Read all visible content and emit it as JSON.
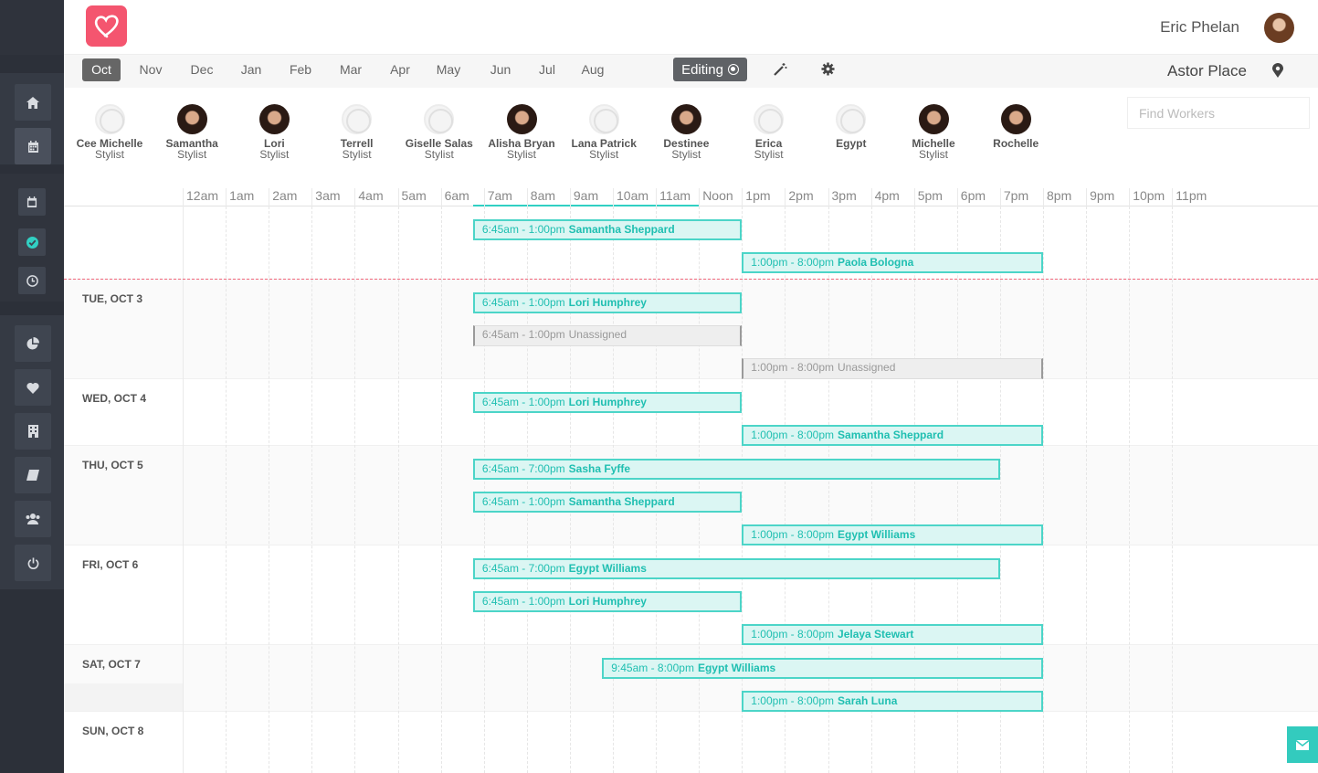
{
  "header": {
    "user_name": "Eric Phelan"
  },
  "toolbar": {
    "months": [
      "Oct",
      "Nov",
      "Dec",
      "Jan",
      "Feb",
      "Mar",
      "Apr",
      "May",
      "Jun",
      "Jul",
      "Aug"
    ],
    "active_month": "Oct",
    "editing_label": "Editing",
    "location": "Astor Place"
  },
  "workers": [
    {
      "name": "Cee Michelle",
      "role": "Stylist",
      "avatar": "placeholder"
    },
    {
      "name": "Samantha",
      "role": "Stylist",
      "avatar": "photo"
    },
    {
      "name": "Lori",
      "role": "Stylist",
      "avatar": "photo"
    },
    {
      "name": "Terrell",
      "role": "Stylist",
      "avatar": "placeholder"
    },
    {
      "name": "Giselle Salas",
      "role": "Stylist",
      "avatar": "placeholder"
    },
    {
      "name": "Alisha Bryan",
      "role": "Stylist",
      "avatar": "photo"
    },
    {
      "name": "Lana Patrick",
      "role": "Stylist",
      "avatar": "placeholder"
    },
    {
      "name": "Destinee",
      "role": "Stylist",
      "avatar": "photo"
    },
    {
      "name": "Erica",
      "role": "Stylist",
      "avatar": "placeholder"
    },
    {
      "name": "Egypt",
      "role": "",
      "avatar": "placeholder"
    },
    {
      "name": "Michelle",
      "role": "Stylist",
      "avatar": "photo"
    },
    {
      "name": "Rochelle",
      "role": "",
      "avatar": "photo"
    }
  ],
  "search": {
    "placeholder": "Find Workers"
  },
  "hours": [
    "12am",
    "1am",
    "2am",
    "3am",
    "4am",
    "5am",
    "6am",
    "7am",
    "8am",
    "9am",
    "10am",
    "11am",
    "Noon",
    "1pm",
    "2pm",
    "3pm",
    "4pm",
    "5pm",
    "6pm",
    "7pm",
    "8pm",
    "9pm",
    "10pm",
    "11pm"
  ],
  "days": [
    {
      "label": "",
      "shifts": [
        {
          "time": "6:45am - 1:00pm",
          "who": "Samantha Sheppard",
          "start": 6.75,
          "end": 13
        },
        {
          "time": "1:00pm - 8:00pm",
          "who": "Paola Bologna",
          "start": 13,
          "end": 20
        }
      ]
    },
    {
      "label": "TUE, OCT 3",
      "shifts": [
        {
          "time": "6:45am - 1:00pm",
          "who": "Lori Humphrey",
          "start": 6.75,
          "end": 13
        },
        {
          "time": "6:45am - 1:00pm",
          "who": "Unassigned",
          "start": 6.75,
          "end": 13,
          "unassigned": true
        },
        {
          "time": "1:00pm - 8:00pm",
          "who": "Unassigned",
          "start": 13,
          "end": 20,
          "unassigned": true
        }
      ]
    },
    {
      "label": "WED, OCT 4",
      "shifts": [
        {
          "time": "6:45am - 1:00pm",
          "who": "Lori Humphrey",
          "start": 6.75,
          "end": 13
        },
        {
          "time": "1:00pm - 8:00pm",
          "who": "Samantha Sheppard",
          "start": 13,
          "end": 20
        }
      ]
    },
    {
      "label": "THU, OCT 5",
      "shifts": [
        {
          "time": "6:45am - 7:00pm",
          "who": "Sasha Fyffe",
          "start": 6.75,
          "end": 19
        },
        {
          "time": "6:45am - 1:00pm",
          "who": "Samantha Sheppard",
          "start": 6.75,
          "end": 13
        },
        {
          "time": "1:00pm - 8:00pm",
          "who": "Egypt Williams",
          "start": 13,
          "end": 20
        }
      ]
    },
    {
      "label": "FRI, OCT 6",
      "shifts": [
        {
          "time": "6:45am - 7:00pm",
          "who": "Egypt Williams",
          "start": 6.75,
          "end": 19
        },
        {
          "time": "6:45am - 1:00pm",
          "who": "Lori Humphrey",
          "start": 6.75,
          "end": 13
        },
        {
          "time": "1:00pm - 8:00pm",
          "who": "Jelaya Stewart",
          "start": 13,
          "end": 20
        }
      ]
    },
    {
      "label": "SAT, OCT 7",
      "shifts": [
        {
          "time": "9:45am - 8:00pm",
          "who": "Egypt Williams",
          "start": 9.75,
          "end": 20
        },
        {
          "time": "1:00pm - 8:00pm",
          "who": "Sarah Luna",
          "start": 13,
          "end": 20
        }
      ]
    },
    {
      "label": "SUN, OCT 8",
      "shifts": []
    }
  ]
}
